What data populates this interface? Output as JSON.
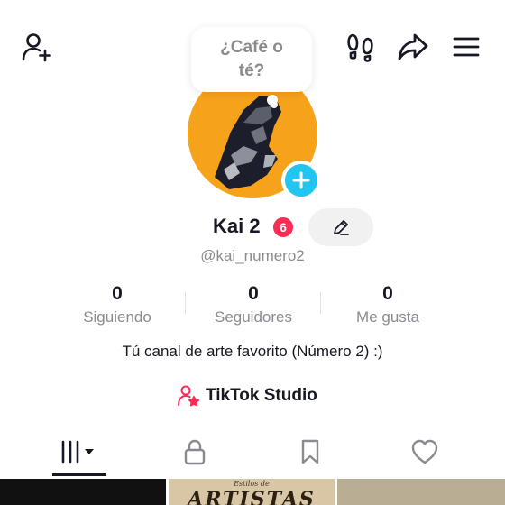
{
  "header": {
    "icons": [
      "add-friend-icon",
      "footprints-icon",
      "share-icon",
      "menu-icon"
    ]
  },
  "note": {
    "text": "¿Café o té?"
  },
  "profile": {
    "display_name": "Kai 2",
    "notification_count": "6",
    "username": "@kai_numero2",
    "bio": "Tú canal de arte favorito (Número 2) :)",
    "avatar_bg_color": "#f7a21b",
    "add_button_color": "#20c5f0"
  },
  "stats": [
    {
      "value": "0",
      "label": "Siguiendo"
    },
    {
      "value": "0",
      "label": "Seguidores"
    },
    {
      "value": "0",
      "label": "Me gusta"
    }
  ],
  "studio": {
    "label": "TikTok Studio",
    "icon": "creator-person-star-icon",
    "icon_color": "#fe2c55"
  },
  "tabs": [
    {
      "name": "videos",
      "icon": "grid-bars-icon",
      "active": true
    },
    {
      "name": "private",
      "icon": "lock-icon",
      "active": false
    },
    {
      "name": "saved",
      "icon": "bookmark-icon",
      "active": false
    },
    {
      "name": "liked",
      "icon": "heart-icon",
      "active": false
    }
  ],
  "thumbnails": [
    {
      "caption_small": "",
      "caption_big": ""
    },
    {
      "caption_small": "Estilos de",
      "caption_big": "ARTISTAS"
    },
    {
      "caption_small": "",
      "caption_big": ""
    }
  ]
}
